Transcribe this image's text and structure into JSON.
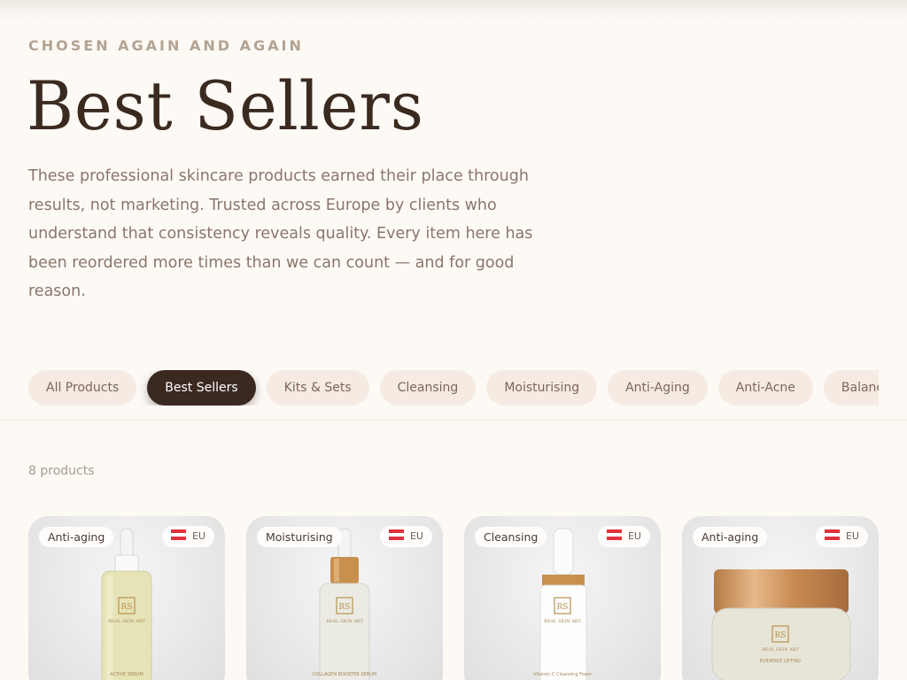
{
  "header": {
    "eyebrow": "CHOSEN AGAIN AND AGAIN",
    "title": "Best Sellers",
    "intro": "These professional skincare products earned their place through results, not marketing. Trusted across Europe by clients who understand that consistency reveals quality. Every item here has been reordered more times than we can count — and for good reason."
  },
  "filters": {
    "items": [
      "All Products",
      "Best Sellers",
      "Kits & Sets",
      "Cleansing",
      "Moisturising",
      "Anti-Aging",
      "Anti-Acne",
      "Balancing"
    ],
    "active": "Best Sellers"
  },
  "results": {
    "count_label": "8 products"
  },
  "products": [
    {
      "badge": "Anti-aging",
      "region": "EU",
      "brand": "REAL SKIN ART",
      "name": "ACTIVE SERUM",
      "type": "dropper-yellow"
    },
    {
      "badge": "Moisturising",
      "region": "EU",
      "brand": "REAL SKIN ART",
      "name": "COLLAGEN BOOSTER SERUM",
      "type": "dropper-gold"
    },
    {
      "badge": "Cleansing",
      "region": "EU",
      "brand": "REAL SKIN ART",
      "name": "Vitamin C Cleansing Foam",
      "type": "pump"
    },
    {
      "badge": "Anti-aging",
      "region": "EU",
      "brand": "REAL SKIN ART",
      "name": "EVIDENCE LIFTING",
      "type": "jar"
    }
  ],
  "colors": {
    "background": "#fdf9f5",
    "accent_dark": "#3b2820",
    "chip_bg": "#f6ebe2",
    "gold": "#c7904f"
  }
}
